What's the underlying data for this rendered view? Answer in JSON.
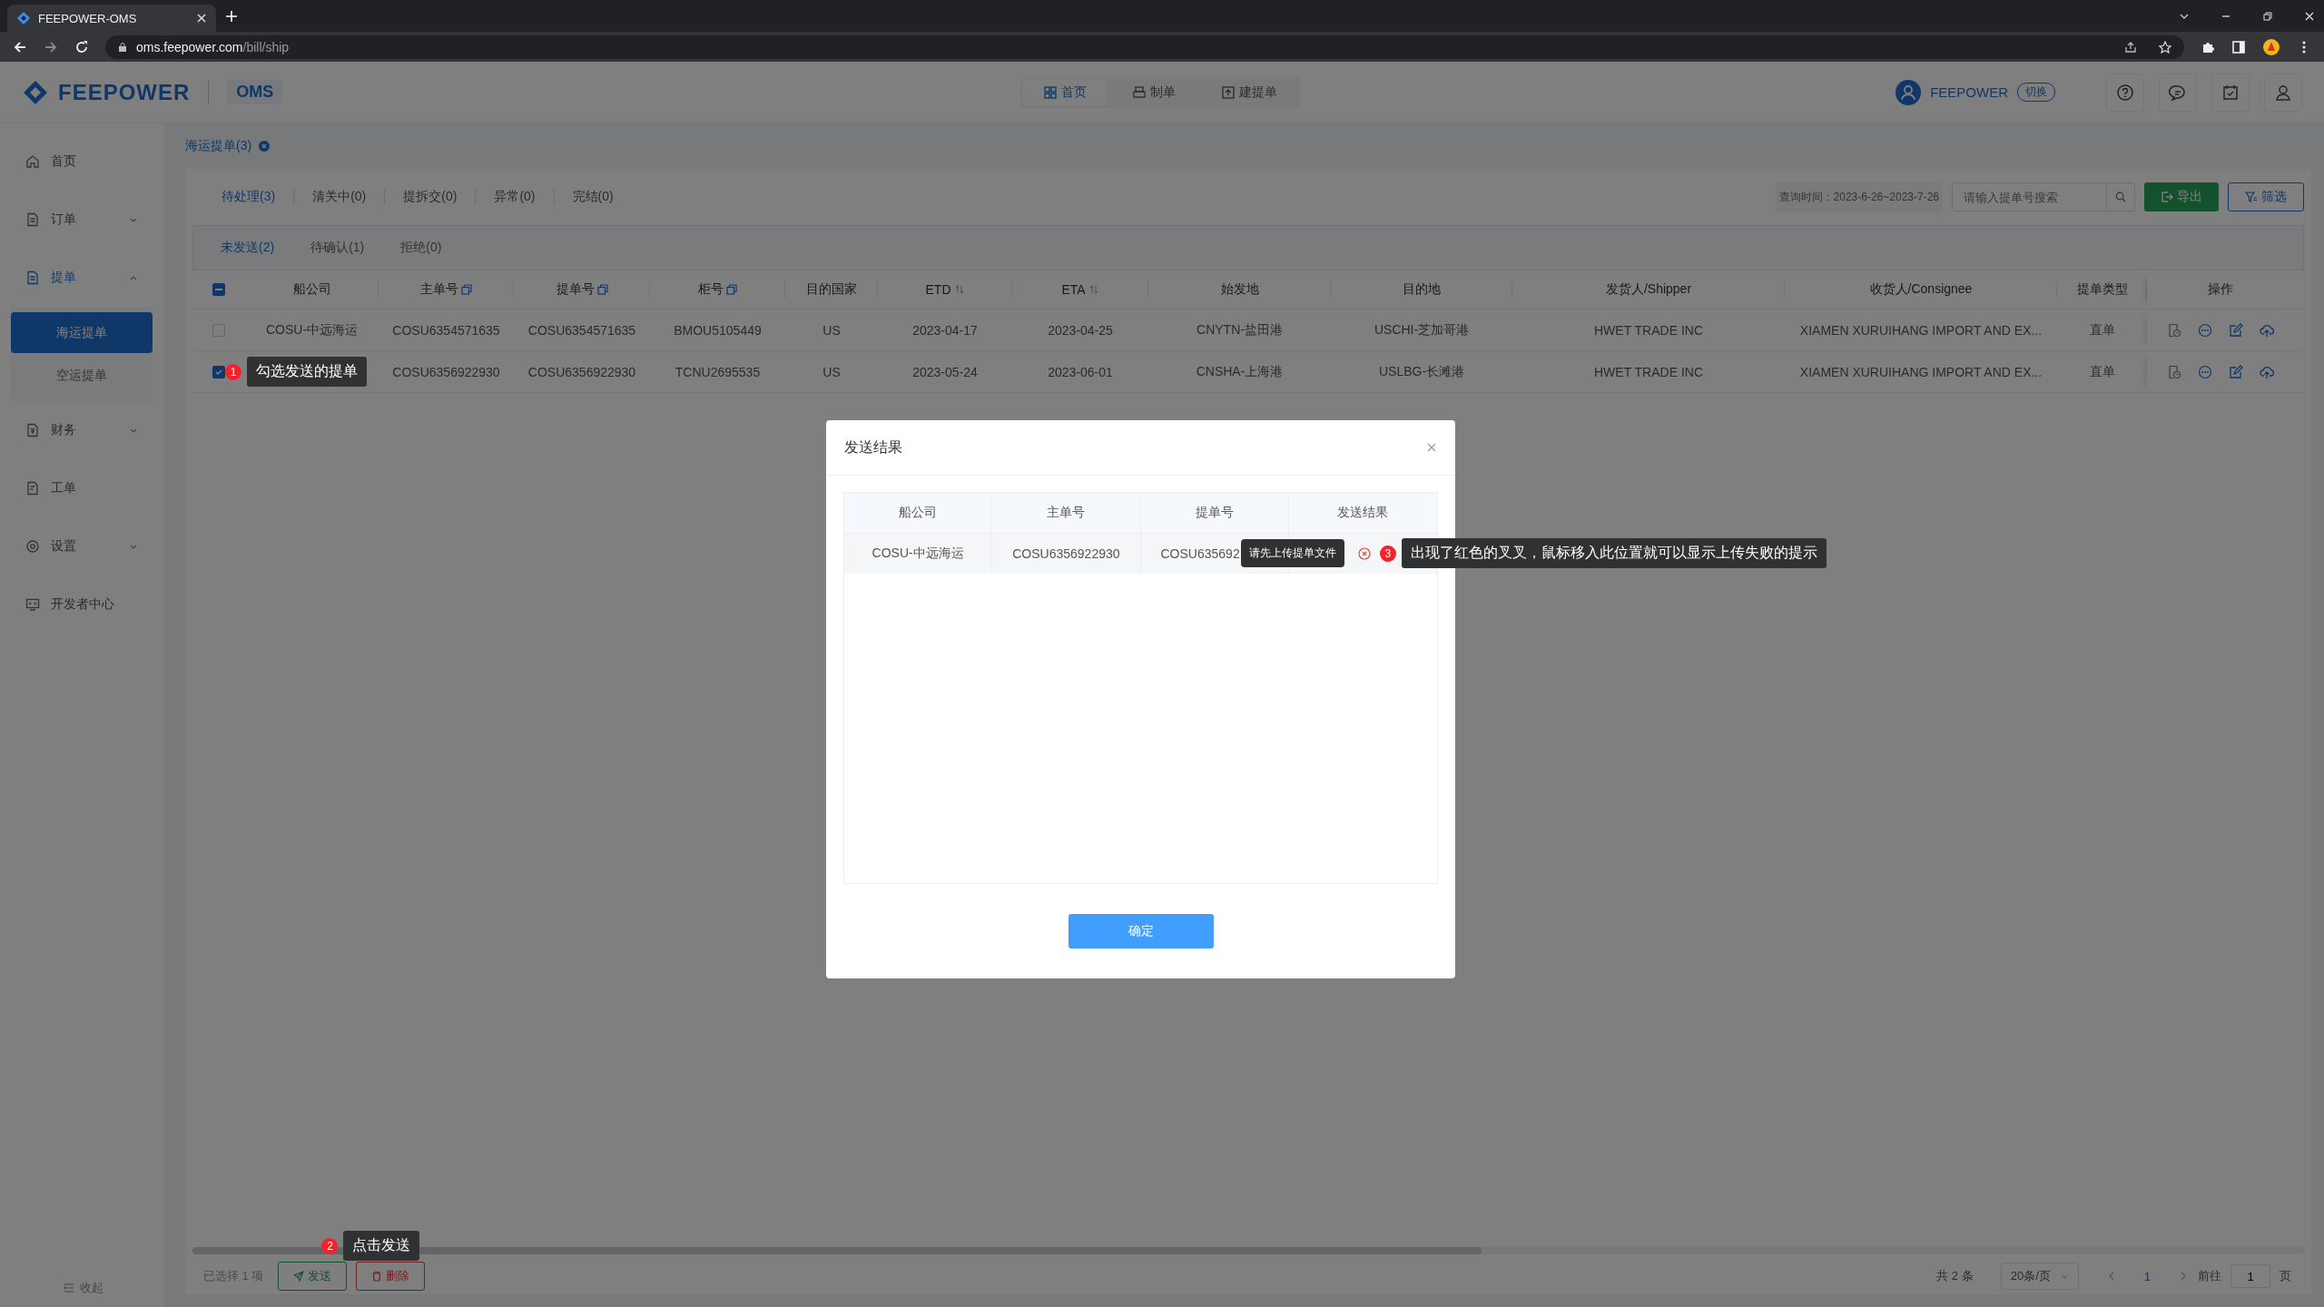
{
  "browser": {
    "tab_title": "FEEPOWER-OMS",
    "url_host": "oms.feepower.com",
    "url_path": "/bill/ship"
  },
  "header": {
    "logo": "FEEPOWER",
    "app": "OMS",
    "nav": [
      {
        "label": "首页",
        "selected": true
      },
      {
        "label": "制单",
        "selected": false
      },
      {
        "label": "建提单",
        "selected": false
      }
    ],
    "account": "FEEPOWER",
    "switch": "切换"
  },
  "sidebar": {
    "items": [
      {
        "label": "首页"
      },
      {
        "label": "订单",
        "expanded": false
      },
      {
        "label": "提单",
        "expanded": true,
        "children": [
          {
            "label": "海运提单",
            "selected": true
          },
          {
            "label": "空运提单",
            "selected": false
          }
        ]
      },
      {
        "label": "财务",
        "expanded": false
      },
      {
        "label": "工单"
      },
      {
        "label": "设置",
        "expanded": false
      },
      {
        "label": "开发者中心"
      }
    ],
    "collapse": "收起"
  },
  "breadcrumb": "海运提单(3)",
  "status_tabs": [
    {
      "label": "待处理(3)",
      "selected": true
    },
    {
      "label": "清关中(0)",
      "selected": false
    },
    {
      "label": "提拆交(0)",
      "selected": false
    },
    {
      "label": "异常(0)",
      "selected": false
    },
    {
      "label": "完结(0)",
      "selected": false
    }
  ],
  "query_time": "查询时间：2023-6-26~2023-7-26",
  "search": {
    "placeholder": "请输入提单号搜索"
  },
  "export": "导出",
  "filter": "筛选",
  "sub_tabs": [
    {
      "label": "未发送(2)",
      "selected": true
    },
    {
      "label": "待确认(1)",
      "selected": false
    },
    {
      "label": "拒绝(0)",
      "selected": false
    }
  ],
  "table": {
    "select_all_partial": true,
    "columns": [
      {
        "label": "船公司",
        "kind": "plain"
      },
      {
        "label": "主单号",
        "kind": "copy"
      },
      {
        "label": "提单号",
        "kind": "copy"
      },
      {
        "label": "柜号",
        "kind": "copy"
      },
      {
        "label": "目的国家",
        "kind": "plain"
      },
      {
        "label": "ETD",
        "kind": "sort"
      },
      {
        "label": "ETA",
        "kind": "sort"
      },
      {
        "label": "始发地",
        "kind": "plain"
      },
      {
        "label": "目的地",
        "kind": "plain"
      },
      {
        "label": "发货人/Shipper",
        "kind": "plain"
      },
      {
        "label": "收货人/Consignee",
        "kind": "plain"
      },
      {
        "label": "提单类型",
        "kind": "plain"
      },
      {
        "label": "操作",
        "kind": "plain"
      }
    ],
    "rows": [
      {
        "checked": false,
        "cells": [
          "COSU-中远海运",
          "COSU6354571635",
          "COSU6354571635",
          "BMOU5105449",
          "US",
          "2023-04-17",
          "2023-04-25",
          "CNYTN-盐田港",
          "USCHI-芝加哥港",
          "HWET TRADE INC",
          "XIAMEN XURUIHANG IMPORT AND EX...",
          "直单"
        ]
      },
      {
        "checked": true,
        "annotation": {
          "number": "1",
          "text": "勾选发送的提单"
        },
        "cells": [
          null,
          "COSU6356922930",
          "COSU6356922930",
          "TCNU2695535",
          "US",
          "2023-05-24",
          "2023-06-01",
          "CNSHA-上海港",
          "USLBG-长滩港",
          "HWET TRADE INC",
          "XIAMEN XURUIHANG IMPORT AND EX...",
          "直单"
        ]
      }
    ]
  },
  "footer": {
    "selected": "已选择 1 项",
    "send": "发送",
    "send_annotation": {
      "number": "2",
      "text": "点击发送"
    },
    "delete": "删除",
    "total": "共 2 条",
    "page_size": "20条/页",
    "pages": [
      {
        "label": "1",
        "selected": true
      }
    ],
    "goto": "前往",
    "goto_value": "1",
    "page_unit": "页"
  },
  "dialog": {
    "title": "发送结果",
    "columns": [
      "船公司",
      "主单号",
      "提单号",
      "发送结果"
    ],
    "rows": [
      {
        "cells": [
          "COSU-中远海运",
          "COSU6356922930",
          "COSU635692"
        ],
        "failed": true,
        "tip": "请先上传提单文件",
        "annotation": {
          "number": "3",
          "text": "出现了红色的叉叉，鼠标移入此位置就可以显示上传失败的提示"
        }
      }
    ],
    "ok": "确定"
  }
}
